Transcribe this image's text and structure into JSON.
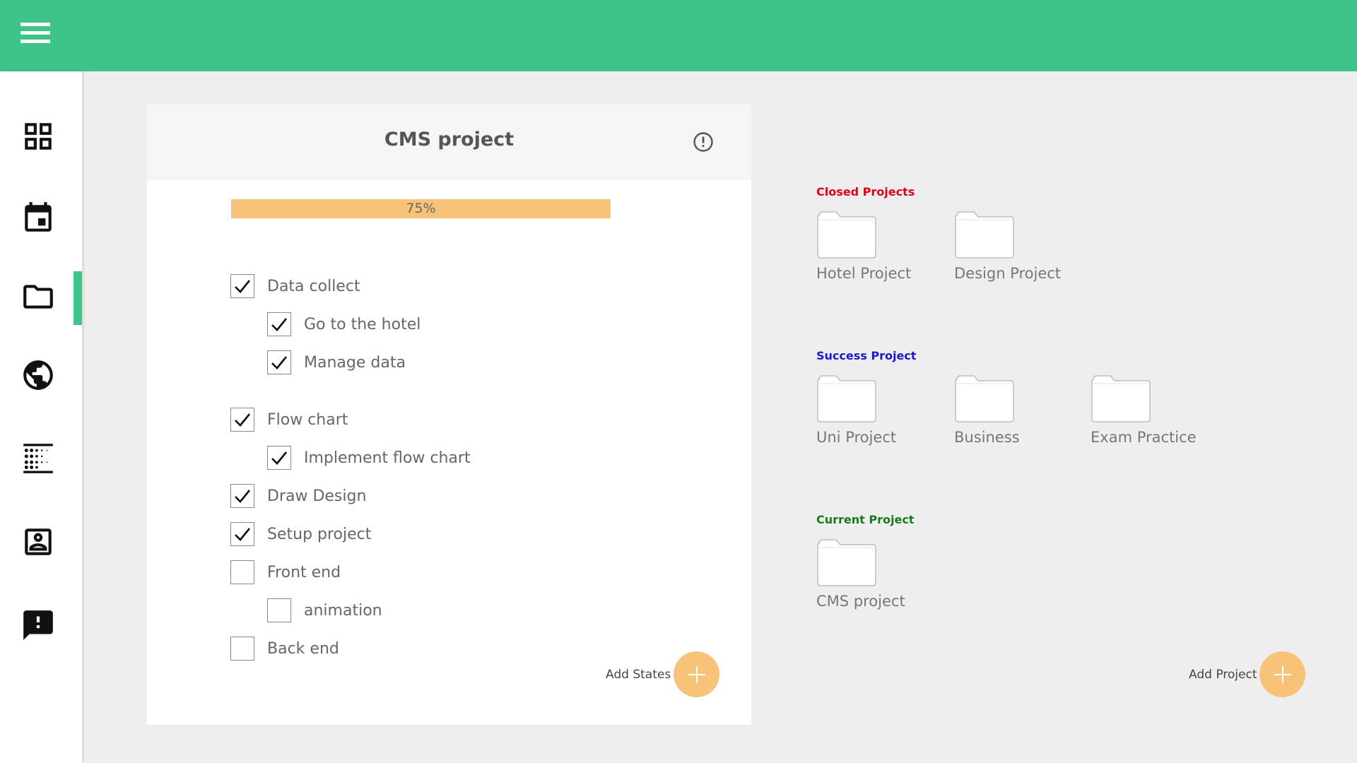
{
  "app": {
    "accent_color": "#3cc587",
    "progress_color": "#f6c378"
  },
  "topbar": {
    "menu_icon": "hamburger-menu-icon"
  },
  "sidebar": {
    "items": [
      {
        "icon": "dashboard-grid-icon"
      },
      {
        "icon": "calendar-icon"
      },
      {
        "icon": "folder-icon",
        "active": true
      },
      {
        "icon": "globe-icon"
      },
      {
        "icon": "dot-grid-list-icon"
      },
      {
        "icon": "contact-card-icon"
      },
      {
        "icon": "feedback-message-icon"
      }
    ]
  },
  "project_card": {
    "title": "CMS project",
    "info_icon": "info-circle-icon",
    "progress": {
      "value": 0.75,
      "label": "75%"
    },
    "tasks": [
      {
        "label": "Data collect",
        "checked": true,
        "level": 0
      },
      {
        "label": "Go to the hotel",
        "checked": true,
        "level": 1
      },
      {
        "label": "Manage data",
        "checked": true,
        "level": 1
      },
      {
        "label": "Flow chart",
        "checked": true,
        "level": 0
      },
      {
        "label": "Implement flow chart",
        "checked": true,
        "level": 1
      },
      {
        "label": "Draw Design",
        "checked": true,
        "level": 0
      },
      {
        "label": "Setup project",
        "checked": true,
        "level": 0
      },
      {
        "label": "Front end",
        "checked": false,
        "level": 0
      },
      {
        "label": "animation",
        "checked": false,
        "level": 1
      },
      {
        "label": "Back end",
        "checked": false,
        "level": 0
      }
    ],
    "add_states_label": "Add States"
  },
  "closed_projects": {
    "title": "Closed Projects",
    "color": "#e0001b",
    "folders": [
      "Hotel Project",
      "Design Project"
    ]
  },
  "success_projects": {
    "title": "Success Project",
    "color": "#1a1acc",
    "folders": [
      "Uni Project",
      "Business",
      "Exam Practice"
    ]
  },
  "current_projects": {
    "title": "Current Project",
    "color": "#1b7a1b",
    "folders": [
      "CMS project"
    ]
  },
  "add_project_label": "Add Project"
}
